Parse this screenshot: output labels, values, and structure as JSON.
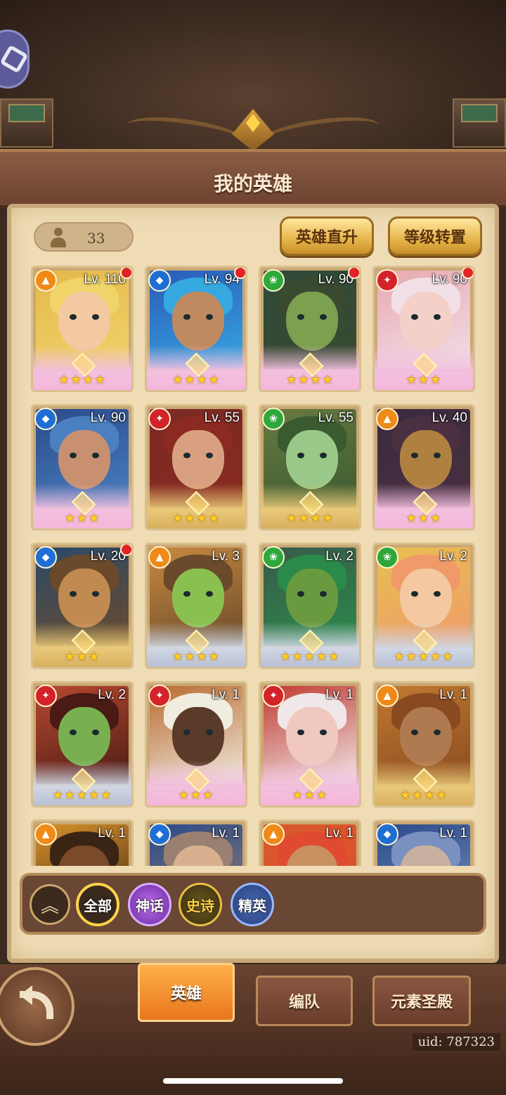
{
  "header": {
    "title": "我的英雄"
  },
  "toolbar": {
    "hero_count": "33",
    "instant_upgrade_label": "英雄直升",
    "level_transfer_label": "等级转置"
  },
  "heroes": [
    {
      "level": "Lv. 110",
      "element": "light",
      "stars": "★★★★",
      "rarity": "mythic",
      "notify": true,
      "palette": [
        "#e4b84a",
        "#f2c9a0",
        "#f0d46a"
      ]
    },
    {
      "level": "Lv. 94",
      "element": "water",
      "stars": "★★★★",
      "rarity": "mythic",
      "notify": true,
      "palette": [
        "#2a5ab8",
        "#c08a60",
        "#36a8e0"
      ]
    },
    {
      "level": "Lv. 90",
      "element": "wind",
      "stars": "★★★★",
      "rarity": "mythic",
      "notify": true,
      "palette": [
        "#2e4a3a",
        "#7aa050",
        "#3a4a30"
      ]
    },
    {
      "level": "Lv. 90",
      "element": "fire",
      "stars": "★★★",
      "rarity": "mythic",
      "notify": true,
      "palette": [
        "#e8a8b0",
        "#f4d0c8",
        "#f2e0e8"
      ]
    },
    {
      "level": "Lv. 90",
      "element": "water",
      "stars": "★★★",
      "rarity": "mythic",
      "notify": false,
      "palette": [
        "#2a4a8a",
        "#c89070",
        "#4a80c0"
      ]
    },
    {
      "level": "Lv. 55",
      "element": "fire",
      "stars": "★★★★",
      "rarity": "epic",
      "notify": false,
      "palette": [
        "#7a2a24",
        "#d8a080",
        "#8a2a20"
      ]
    },
    {
      "level": "Lv. 55",
      "element": "wind",
      "stars": "★★★★",
      "rarity": "epic",
      "notify": false,
      "palette": [
        "#6a7a40",
        "#9ac888",
        "#3a5a30"
      ]
    },
    {
      "level": "Lv. 40",
      "element": "light",
      "stars": "★★★",
      "rarity": "mythic",
      "notify": false,
      "palette": [
        "#3a2a40",
        "#b08040",
        "#4a3040"
      ]
    },
    {
      "level": "Lv. 20",
      "element": "water",
      "stars": "★★★",
      "rarity": "epic",
      "notify": true,
      "palette": [
        "#2a4a6a",
        "#c08a50",
        "#6a4a2a"
      ]
    },
    {
      "level": "Lv. 3",
      "element": "light",
      "stars": "★★★★",
      "rarity": "elite",
      "notify": false,
      "palette": [
        "#c88a40",
        "#8ac050",
        "#6a4a2a"
      ]
    },
    {
      "level": "Lv. 2",
      "element": "wind",
      "stars": "★★★★★",
      "rarity": "elite",
      "notify": false,
      "palette": [
        "#3a5a4a",
        "#6a9a40",
        "#2a8a4a"
      ]
    },
    {
      "level": "Lv. 2",
      "element": "wind",
      "stars": "★★★★★",
      "rarity": "elite",
      "notify": false,
      "palette": [
        "#e8c050",
        "#f4c8a0",
        "#f09a6a"
      ]
    },
    {
      "level": "Lv. 2",
      "element": "fire",
      "stars": "★★★★★",
      "rarity": "elite",
      "notify": false,
      "palette": [
        "#b84a30",
        "#78b050",
        "#4a1a14"
      ]
    },
    {
      "level": "Lv. 1",
      "element": "fire",
      "stars": "★★★",
      "rarity": "mythic",
      "notify": false,
      "palette": [
        "#b86a30",
        "#5a3a28",
        "#f0ece0"
      ]
    },
    {
      "level": "Lv. 1",
      "element": "fire",
      "stars": "★★★",
      "rarity": "mythic",
      "notify": false,
      "palette": [
        "#c03a30",
        "#f0c8c0",
        "#f0e8e8"
      ]
    },
    {
      "level": "Lv. 1",
      "element": "light",
      "stars": "★★★★",
      "rarity": "epic",
      "notify": false,
      "palette": [
        "#c07a30",
        "#b07a50",
        "#8a4a20"
      ]
    },
    {
      "level": "Lv. 1",
      "element": "light",
      "stars": "",
      "rarity": "epic",
      "notify": false,
      "palette": [
        "#d8902a",
        "#7a4a2a",
        "#3a2414"
      ]
    },
    {
      "level": "Lv. 1",
      "element": "water",
      "stars": "",
      "rarity": "epic",
      "notify": false,
      "palette": [
        "#2a4a8a",
        "#d8b090",
        "#9a8070"
      ]
    },
    {
      "level": "Lv. 1",
      "element": "light",
      "stars": "",
      "rarity": "epic",
      "notify": false,
      "palette": [
        "#d85a2a",
        "#c89060",
        "#e04a30"
      ]
    },
    {
      "level": "Lv. 1",
      "element": "water",
      "stars": "",
      "rarity": "epic",
      "notify": false,
      "palette": [
        "#2a4a8a",
        "#c8b0a0",
        "#7a90c0"
      ]
    }
  ],
  "filters": {
    "all_label": "全部",
    "mythic_label": "神话",
    "epic_label": "史诗",
    "elite_label": "精英",
    "selected": "全部"
  },
  "tabs": {
    "heroes_label": "英雄",
    "team_label": "编队",
    "shrine_label": "元素圣殿",
    "active": "英雄"
  },
  "footer": {
    "uid": "uid: 787323"
  }
}
